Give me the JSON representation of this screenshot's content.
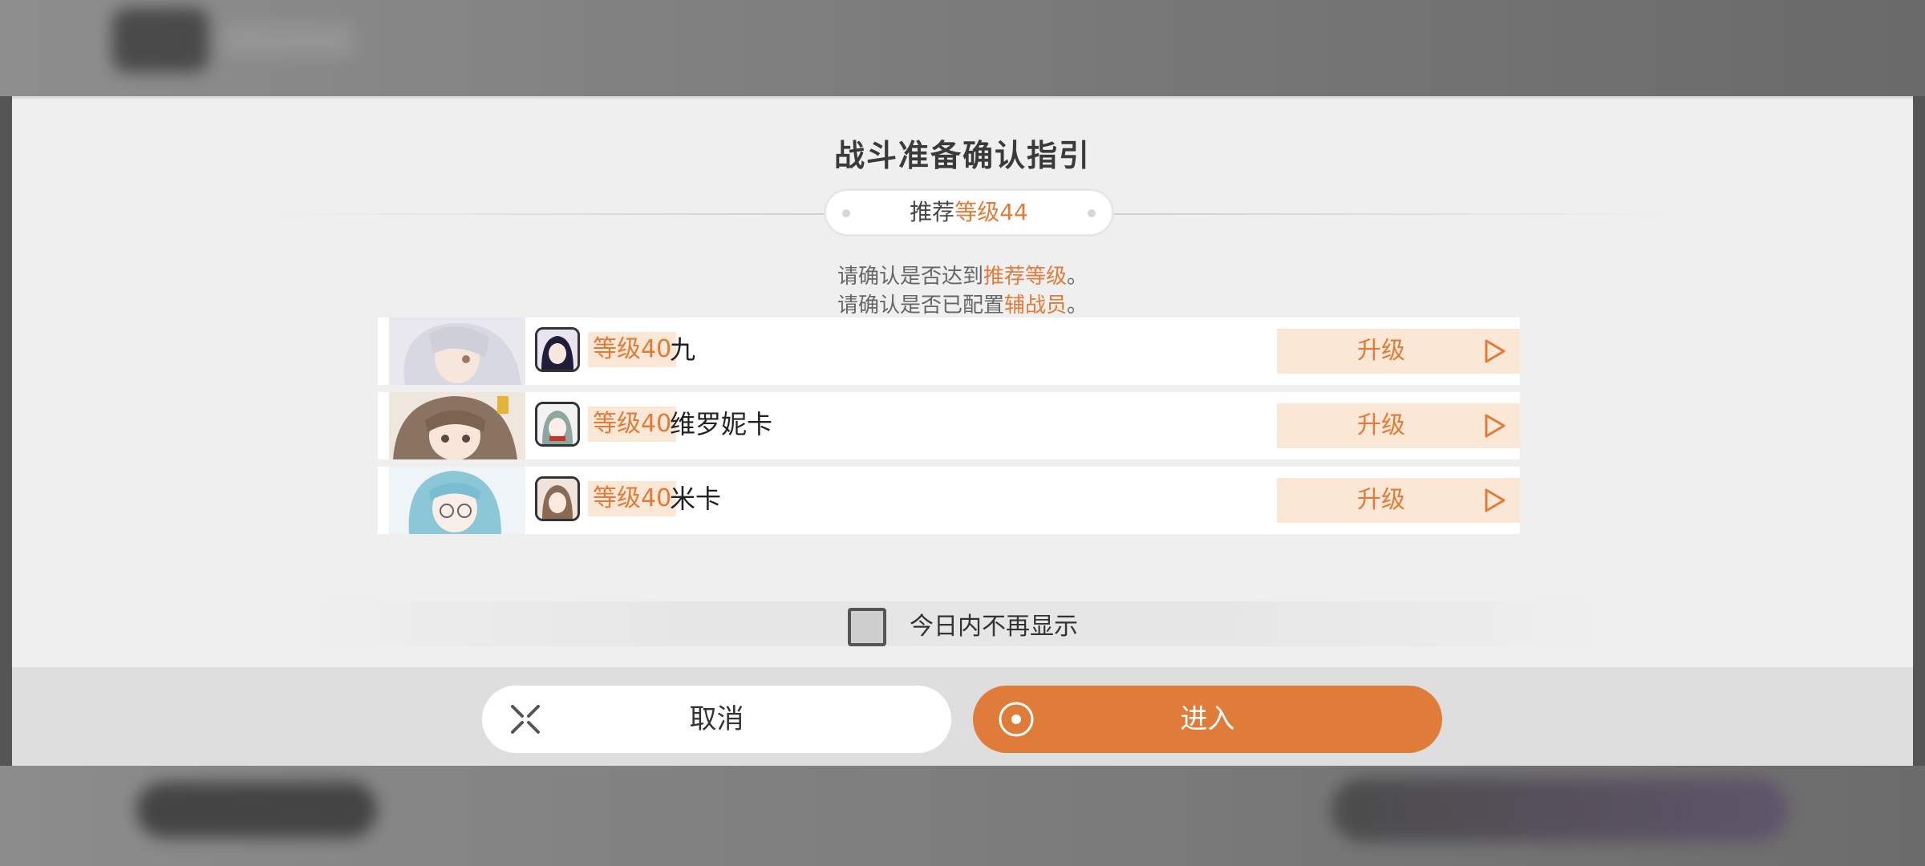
{
  "dialog": {
    "title": "战斗准备确认指引",
    "recommend_prefix": "推荐",
    "recommend_level": "等级44",
    "hint_line1_prefix": "请确认是否达到",
    "hint_line1_highlight": "推荐等级",
    "hint_line1_suffix": "。",
    "hint_line2_prefix": "请确认是否已配置",
    "hint_line2_highlight": "辅战员",
    "hint_line2_suffix": "。"
  },
  "members": [
    {
      "level": "等级40",
      "name": "九",
      "upgrade_label": "升级"
    },
    {
      "level": "等级40",
      "name": "维罗妮卡",
      "upgrade_label": "升级"
    },
    {
      "level": "等级40",
      "name": "米卡",
      "upgrade_label": "升级"
    }
  ],
  "dont_show_today": {
    "label": "今日内不再显示",
    "checked": false
  },
  "buttons": {
    "cancel": "取消",
    "enter": "进入"
  },
  "colors": {
    "accent": "#e07c3a",
    "accent_light": "#fbe7d6",
    "panel": "#efefef"
  }
}
